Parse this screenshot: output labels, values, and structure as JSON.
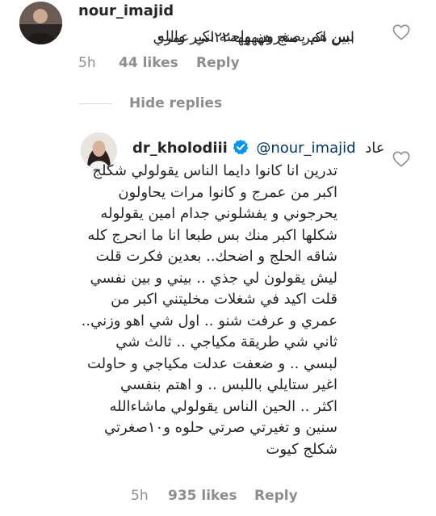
{
  "comment1": {
    "username": "nour_imajid",
    "text_lines": [
      "بس هم يصغرون واحنه نكبر والله",
      "ابين اكبر منج هههههه٢٢اني عمري"
    ],
    "time": "5h",
    "likes": "44 likes",
    "reply": "Reply",
    "avatar_icon": "profile-photo"
  },
  "hide_replies": "Hide replies",
  "comment2": {
    "username": "dr_kholodiii",
    "verified_icon": "verified-badge-icon",
    "mention": "@nour_imajid",
    "first_word": "عاد",
    "text_lines": [
      "تدرين انا كانوا دايما الناس يقولولي شكلج",
      "اكبر من عمرج و كانوا مرات يحاولون",
      "يحرجوني و يفشلوني جدام امين يقولوله",
      "شكلها اكبر منك بس طبعا انا ما انحرج كله",
      "شاقه الحلج و اضحك.. بعدين فكرت قلت",
      "ليش يقولون لي جذي .. بيني و بين نفسي",
      "قلت اكيد في شغلات مخليتني اكبر من",
      "عمري و عرفت شنو .. اول شي اهو وزني..",
      "ثاني شي طريقة مكياجي .. ثالث شي",
      "لبسي .. و ضعفت عدلت مكياجي و حاولت",
      "اغير ستايلي باللبس .. و اهتم بنفسي",
      "اكثر .. الحين الناس يقولولي ماشاءالله",
      "سنين و تغيرتي صرتي حلوه و١٠صغرتي",
      "شكلج كيوت"
    ],
    "time": "5h",
    "likes": "935 likes",
    "reply": "Reply",
    "avatar_icon": "profile-photo"
  },
  "colors": {
    "text": "#262626",
    "meta": "#8e8e8e",
    "verified": "#0095f6",
    "mention": "#00376b"
  }
}
